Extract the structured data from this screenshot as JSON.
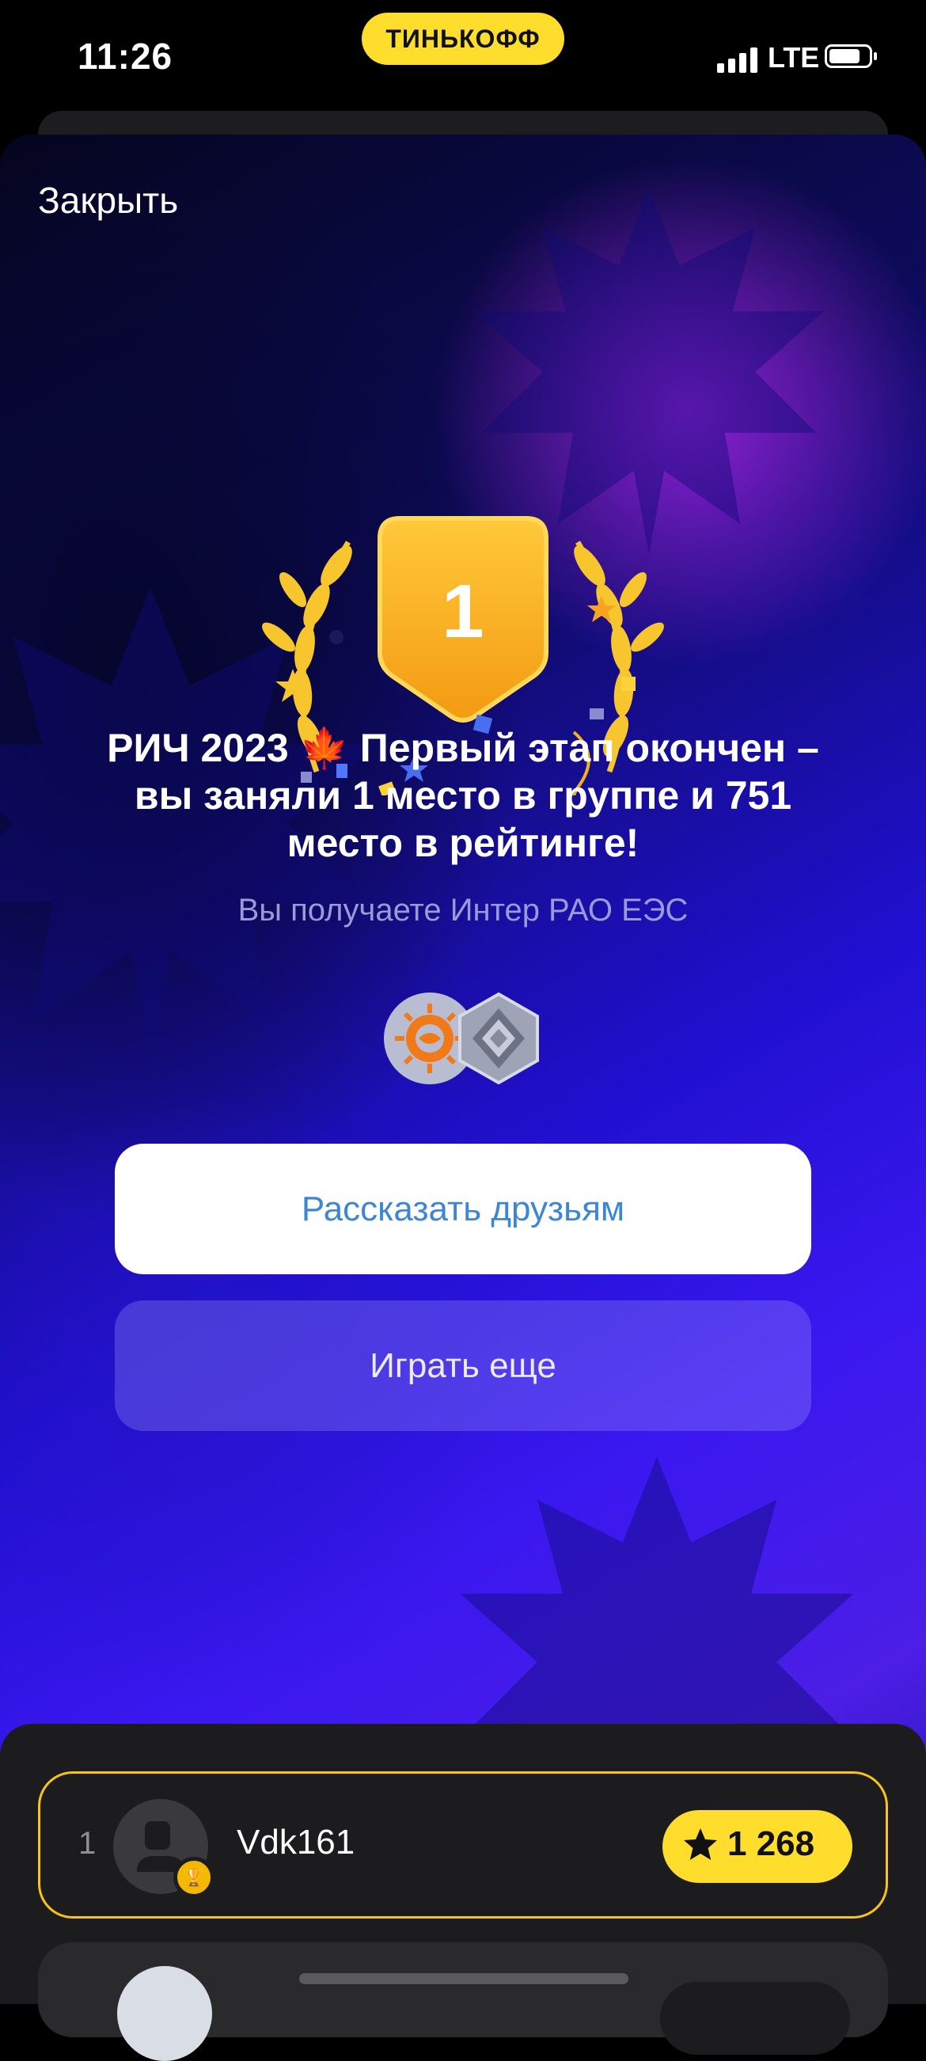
{
  "status_bar": {
    "time": "11:26",
    "brand": "ТИНЬКОФФ",
    "network": "LTE"
  },
  "modal": {
    "close_label": "Закрыть",
    "medal_place": "1",
    "title_parts": [
      "РИЧ 2023 ",
      "🍁",
      " Первый этап окончен – вы заняли 1 место в группе и 751 место в рейтинге!"
    ],
    "subtitle": "Вы получаете Интер РАО ЕЭС",
    "share_button": "Рассказать друзьям",
    "play_button": "Играть еще"
  },
  "leaderboard": {
    "rows": [
      {
        "rank": "1",
        "username": "Vdk161",
        "score": "1 268",
        "highlighted": true
      }
    ]
  },
  "colors": {
    "brand_yellow": "#ffdd2d",
    "link_blue": "#3d86d6",
    "highlight_border": "#f5c518"
  }
}
